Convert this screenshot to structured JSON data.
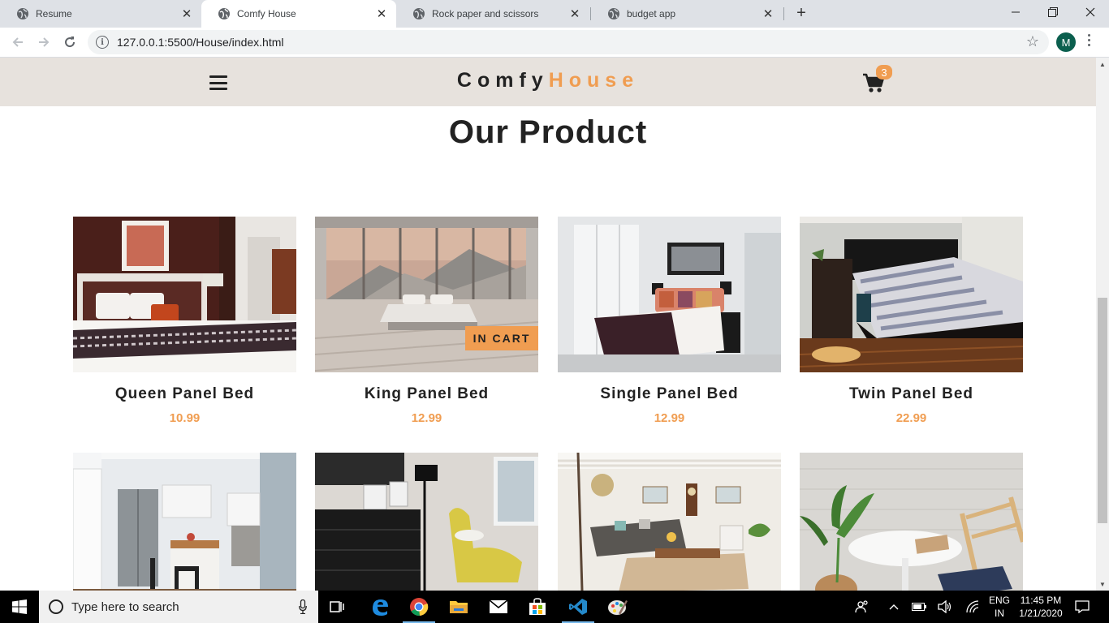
{
  "browser": {
    "tabs": [
      {
        "title": "Resume",
        "active": false
      },
      {
        "title": "Comfy House",
        "active": true
      },
      {
        "title": "Rock paper and scissors",
        "active": false
      },
      {
        "title": "budget app",
        "active": false
      }
    ],
    "url": "127.0.0.1:5500/House/index.html",
    "profile_initial": "M"
  },
  "site": {
    "logo_part1": "Comfy",
    "logo_part2": "House",
    "cart_count": "3",
    "accent_color": "#f09d51",
    "nav_bg": "#e7e2dd"
  },
  "section": {
    "title": "Our Product"
  },
  "products": [
    {
      "name": "Queen Panel Bed",
      "price": "10.99",
      "in_cart": false
    },
    {
      "name": "King Panel Bed",
      "price": "12.99",
      "in_cart": true,
      "badge": "IN CART"
    },
    {
      "name": "Single Panel Bed",
      "price": "12.99",
      "in_cart": false
    },
    {
      "name": "Twin Panel Bed",
      "price": "22.99",
      "in_cart": false
    },
    {
      "name": "",
      "price": ""
    },
    {
      "name": "",
      "price": ""
    },
    {
      "name": "",
      "price": ""
    },
    {
      "name": "",
      "price": ""
    }
  ],
  "taskbar": {
    "search_placeholder": "Type here to search",
    "lang_1": "ENG",
    "lang_2": "IN",
    "time": "11:45 PM",
    "date": "1/21/2020"
  }
}
